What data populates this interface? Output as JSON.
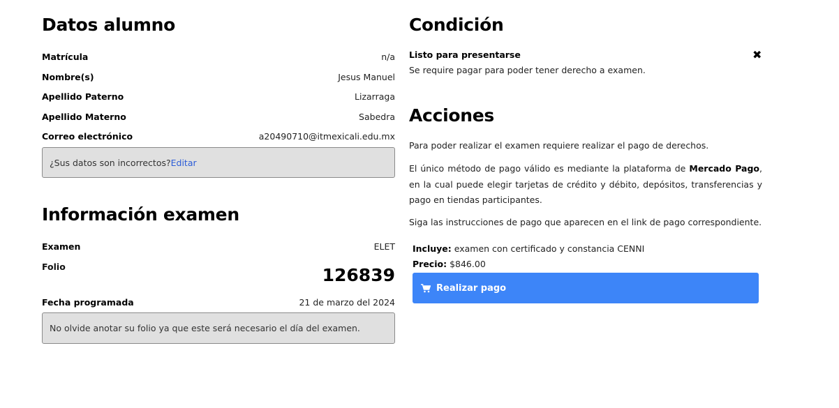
{
  "datos_alumno": {
    "title": "Datos alumno",
    "fields": [
      {
        "label": "Matrícula",
        "value": "n/a"
      },
      {
        "label": "Nombre(s)",
        "value": "Jesus Manuel"
      },
      {
        "label": "Apellido Paterno",
        "value": "Lizarraga"
      },
      {
        "label": "Apellido Materno",
        "value": "Sabedra"
      },
      {
        "label": "Correo electrónico",
        "value": "a20490710@itmexicali.edu.mx"
      }
    ],
    "notice_text": "¿Sus datos son incorrectos?",
    "edit_link": "Editar"
  },
  "info_examen": {
    "title": "Información examen",
    "examen_label": "Examen",
    "examen_value": "ELET",
    "folio_label": "Folio",
    "folio_value": "126839",
    "fecha_label": "Fecha programada",
    "fecha_value": "21 de marzo del 2024",
    "notice": "No olvide anotar su folio ya que este será necesario el día del examen."
  },
  "condicion": {
    "title": "Condición",
    "status_label": "Listo para presentarse",
    "status_icon": "close-icon",
    "message": "Se require pagar para poder tener derecho a examen."
  },
  "acciones": {
    "title": "Acciones",
    "p1": "Para poder realizar el examen requiere realizar el pago de derechos.",
    "p2_before": "El único método de pago válido es mediante la plataforma de ",
    "p2_bold": "Mercado Pago",
    "p2_after": ", en la cual puede elegir tarjetas de crédito y débito, depósitos, transferencias y pago en tiendas participantes.",
    "p3": "Siga las instrucciones de pago que aparecen en el link de pago correspondiente.",
    "incluye_label": "Incluye:",
    "incluye_value": "examen con certificado y constancia CENNI",
    "precio_label": "Precio:",
    "precio_value": "$846.00",
    "pay_button": "Realizar pago",
    "button_color": "#3d85f8"
  }
}
